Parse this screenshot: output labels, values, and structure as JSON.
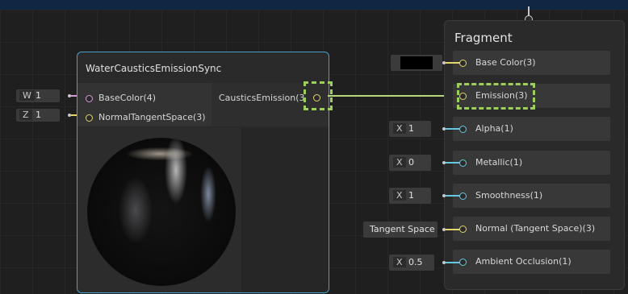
{
  "fragment": {
    "title": "Fragment",
    "slots": [
      {
        "label": "Base Color(3)"
      },
      {
        "label": "Emission(3)"
      },
      {
        "label": "Alpha(1)"
      },
      {
        "label": "Metallic(1)"
      },
      {
        "label": "Smoothness(1)"
      },
      {
        "label": "Normal (Tangent Space)(3)"
      },
      {
        "label": "Ambient Occlusion(1)"
      }
    ],
    "inputs": {
      "alpha": {
        "axis": "X",
        "value": "1"
      },
      "metallic": {
        "axis": "X",
        "value": "0"
      },
      "smoothness": {
        "axis": "X",
        "value": "1"
      },
      "normal_space": "Tangent Space",
      "occlusion": {
        "axis": "X",
        "value": "0.5"
      }
    },
    "base_color_swatch": "#000000"
  },
  "water_node": {
    "title": "WaterCausticsEmissionSync",
    "inputs": [
      "BaseColor(4)",
      "NormalTangentSpace(3)"
    ],
    "output": "CausticsEmission(3"
  },
  "left_inputs": [
    {
      "axis": "W",
      "value": "1"
    },
    {
      "axis": "Z",
      "value": "1"
    }
  ],
  "colors": {
    "accent_blue": "#66c8de",
    "accent_yellow": "#e2d66b",
    "highlight_green": "#9cd05a",
    "node_border": "#4aa0c8"
  }
}
